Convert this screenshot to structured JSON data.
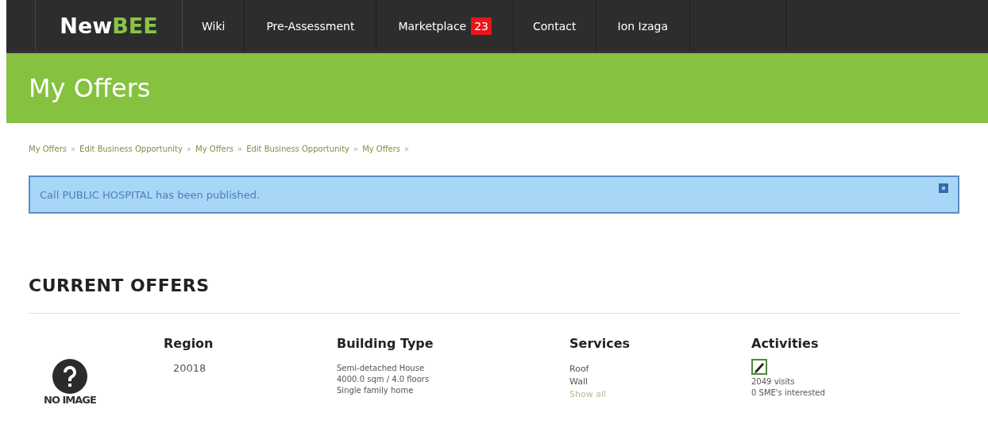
{
  "logo": {
    "first": "New",
    "second": "BEE"
  },
  "nav": [
    {
      "label": "Wiki"
    },
    {
      "label": "Pre-Assessment"
    },
    {
      "label": "Marketplace",
      "badge": "23"
    },
    {
      "label": "Contact"
    },
    {
      "label": "Ion Izaga"
    }
  ],
  "page_title": "My Offers",
  "breadcrumbs": {
    "separator": "»",
    "items": [
      "My Offers",
      "Edit Business Opportunity",
      "My Offers",
      "Edit Business Opportunity",
      "My Offers"
    ]
  },
  "alert": {
    "message": "Call PUBLIC HOSPITAL has been published."
  },
  "section_title": "CURRENT OFFERS",
  "columns": [
    "Region",
    "Building Type",
    "Services",
    "Activities"
  ],
  "offers": [
    {
      "image_label": "NO IMAGE",
      "region": "20018",
      "building": [
        "Semi-detached House",
        "4000.0 sqm / 4.0 floors",
        "Single family home"
      ],
      "services": [
        "Roof",
        "Wall"
      ],
      "show_all": "Show all",
      "visits": "2049 visits",
      "interested": "0 SME's interested"
    }
  ]
}
